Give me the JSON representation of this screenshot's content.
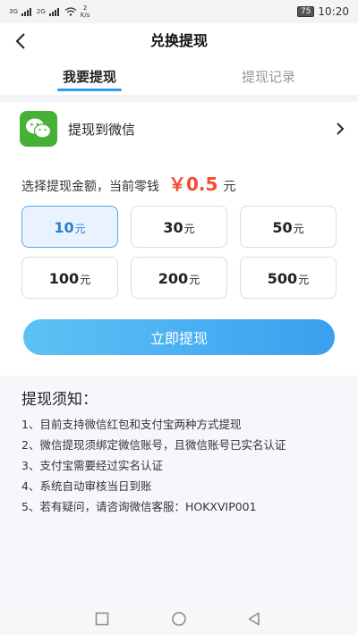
{
  "status_bar": {
    "signal_1": "3G",
    "signal_2": "2G",
    "speed_value": "2",
    "speed_unit": "K/s",
    "battery": "75",
    "time": "10:20"
  },
  "nav": {
    "title": "兑换提现"
  },
  "tabs": [
    {
      "label": "我要提现",
      "active": true
    },
    {
      "label": "提现记录",
      "active": false
    }
  ],
  "wechat": {
    "label": "提现到微信",
    "brand_color": "#45b135"
  },
  "amount": {
    "prompt": "选择提现金额，当前零钱",
    "balance": "￥0.5",
    "unit": "元",
    "accent_color": "#f04b2d"
  },
  "options": [
    {
      "value": "10",
      "unit": "元",
      "selected": true
    },
    {
      "value": "30",
      "unit": "元",
      "selected": false
    },
    {
      "value": "50",
      "unit": "元",
      "selected": false
    },
    {
      "value": "100",
      "unit": "元",
      "selected": false
    },
    {
      "value": "200",
      "unit": "元",
      "selected": false
    },
    {
      "value": "500",
      "unit": "元",
      "selected": false
    }
  ],
  "withdraw_button": {
    "label": "立即提现",
    "color": "#3a9fef"
  },
  "notice": {
    "title": "提现须知：",
    "items": [
      "1、目前支持微信红包和支付宝两种方式提现",
      "2、微信提现须绑定微信账号，且微信账号已实名认证",
      "3、支付宝需要经过实名认证",
      "4、系统自动审核当日到账",
      "5、若有疑问，请咨询微信客服：HOKXVIP001"
    ]
  },
  "system_nav": {
    "icons": [
      "recent-apps-icon",
      "home-icon",
      "back-triangle-icon"
    ]
  }
}
